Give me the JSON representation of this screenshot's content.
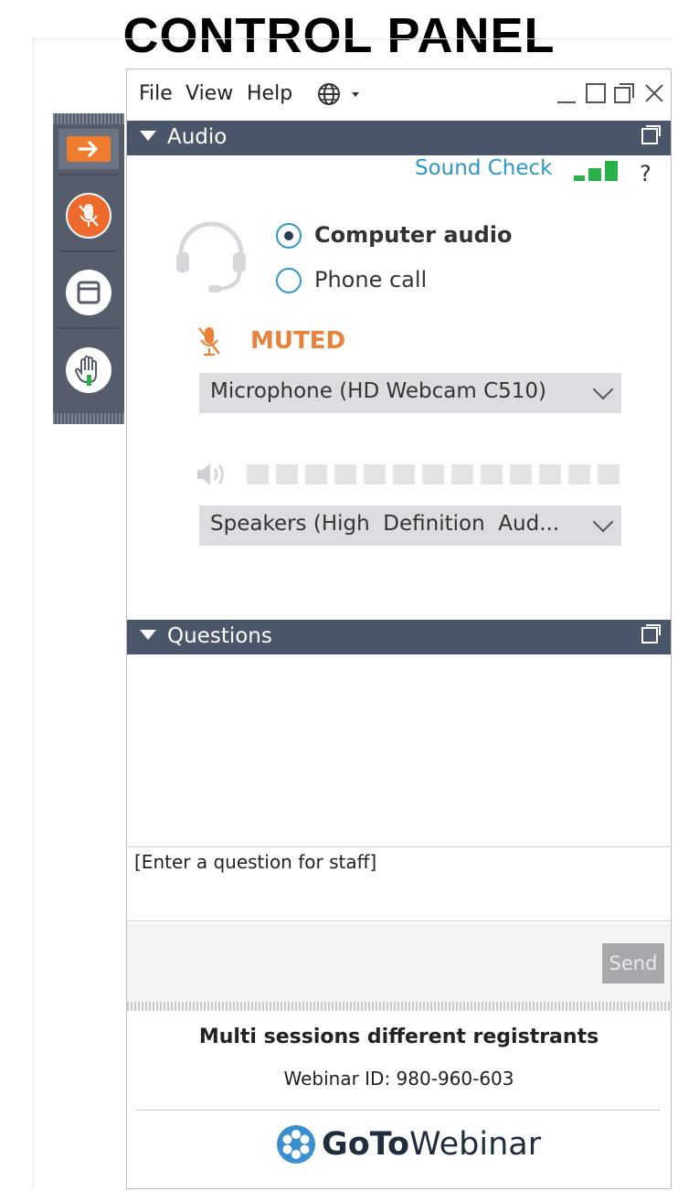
{
  "heading": "CONTROL PANEL",
  "menu": {
    "file": "File",
    "view": "View",
    "help": "Help"
  },
  "audio": {
    "header": "Audio",
    "sound_check": "Sound Check",
    "help_symbol": "?",
    "options": [
      "Computer audio",
      "Phone call"
    ],
    "selected_option": "Computer audio",
    "muted_label": "MUTED",
    "microphone": "Microphone (HD Webcam C510)",
    "speakers": "Speakers (High  Definition  Aud...",
    "volume_level": 0
  },
  "questions": {
    "header": "Questions",
    "input_placeholder": "[Enter a question for staff]",
    "send_label": "Send"
  },
  "footer": {
    "session_name": "Multi sessions different registrants",
    "webinar_id": "Webinar ID: 980-960-603",
    "brand_bold": "GoTo",
    "brand_regular": "Webinar"
  },
  "colors": {
    "accent_orange": "#e8823a",
    "header_bg": "#4c566a",
    "link_blue": "#2f96c5",
    "signal_green": "#2bb04a"
  },
  "icons": [
    "arrow-right-icon",
    "mic-muted-icon",
    "window-icon",
    "raise-hand-icon",
    "globe-icon",
    "minimize-icon",
    "maximize-icon",
    "popout-icon",
    "close-icon",
    "headset-icon",
    "speaker-icon",
    "chevron-down-icon",
    "gotowebinar-logo-icon"
  ]
}
